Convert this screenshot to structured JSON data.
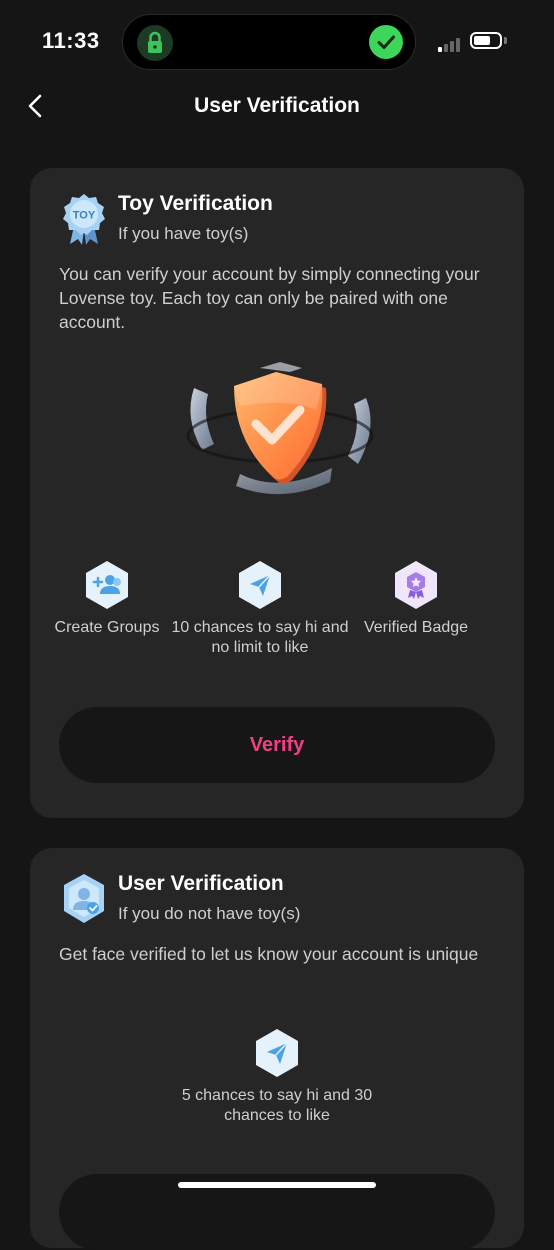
{
  "status_bar": {
    "time": "11:33"
  },
  "nav": {
    "title": "User Verification"
  },
  "toy_card": {
    "title": "Toy Verification",
    "subtitle": "If you have toy(s)",
    "icon_text": "TOY",
    "description": "You can verify your account by simply connecting your Lovense toy. Each toy can only be paired with one account.",
    "benefits": [
      {
        "icon": "add-group-icon",
        "label": "Create Groups"
      },
      {
        "icon": "send-icon",
        "label": "10 chances to say hi and no limit to like"
      },
      {
        "icon": "badge-icon",
        "label": "Verified Badge"
      }
    ],
    "button_label": "Verify"
  },
  "user_card": {
    "title": "User Verification",
    "subtitle": "If you do not have toy(s)",
    "description": "Get face verified to let us know your account is unique",
    "benefits": [
      {
        "icon": "send-icon",
        "label": "5 chances to say hi and 30 chances to like"
      }
    ]
  },
  "colors": {
    "accent": "#f0407f",
    "background": "#151515",
    "card": "#262626"
  }
}
